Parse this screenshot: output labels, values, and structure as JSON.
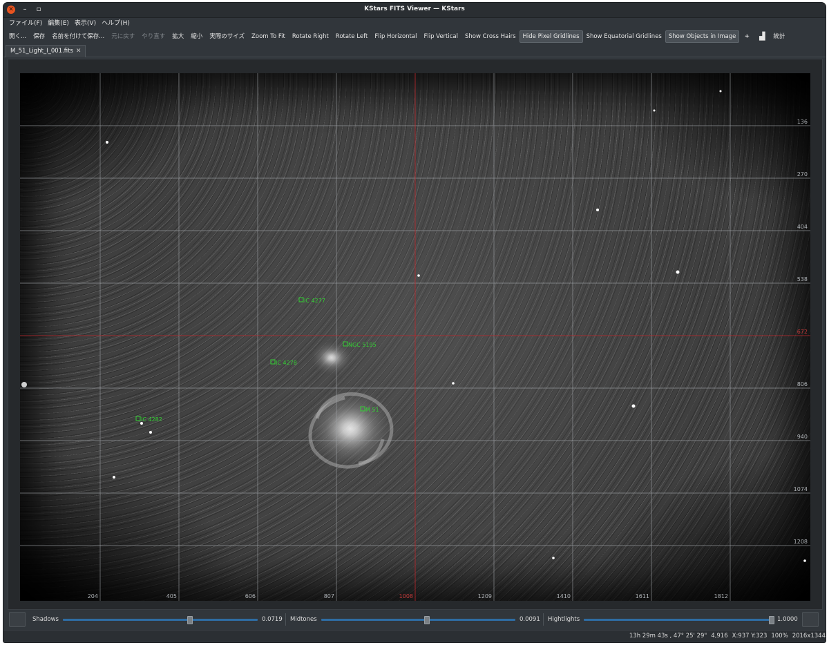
{
  "window": {
    "title": "KStars FITS Viewer — KStars",
    "close_glyph": "✕",
    "minimize_glyph": "–",
    "maximize_glyph": "▫"
  },
  "menu": [
    "ファイル(F)",
    "編集(E)",
    "表示(V)",
    "ヘルプ(H)"
  ],
  "toolbar": [
    {
      "label": "開く...",
      "state": "normal"
    },
    {
      "label": "保存",
      "state": "normal"
    },
    {
      "label": "名前を付けて保存...",
      "state": "normal"
    },
    {
      "label": "元に戻す",
      "state": "disabled"
    },
    {
      "label": "やり直す",
      "state": "disabled"
    },
    {
      "label": "拡大",
      "state": "normal"
    },
    {
      "label": "縮小",
      "state": "normal"
    },
    {
      "label": "実際のサイズ",
      "state": "normal"
    },
    {
      "label": "Zoom To Fit",
      "state": "normal"
    },
    {
      "label": "Rotate Right",
      "state": "normal"
    },
    {
      "label": "Rotate Left",
      "state": "normal"
    },
    {
      "label": "Flip Horizontal",
      "state": "normal"
    },
    {
      "label": "Flip Vertical",
      "state": "normal"
    },
    {
      "label": "Show Cross Hairs",
      "state": "normal"
    },
    {
      "label": "Hide Pixel Gridlines",
      "state": "checked"
    },
    {
      "label": "Show Equatorial Gridlines",
      "state": "normal"
    },
    {
      "label": "Show Objects in Image",
      "state": "checked"
    }
  ],
  "toolbar_icons": {
    "crosshair": "⌖",
    "histogram": "▟"
  },
  "toolbar_stats_label": "統計",
  "tab": {
    "label": "M_51_Light_I_001.fits",
    "close_glyph": "✕"
  },
  "image": {
    "x_axis_labels": [
      "204",
      "405",
      "606",
      "807",
      "1008",
      "1209",
      "1410",
      "1611",
      "1812"
    ],
    "y_axis_labels": [
      "136",
      "270",
      "404",
      "538",
      "672",
      "806",
      "940",
      "1074",
      "1208"
    ],
    "crosshair_x_label": "1008",
    "crosshair_y_label": "672",
    "objects": [
      {
        "name": "IC 4277"
      },
      {
        "name": "NGC 5195"
      },
      {
        "name": "IC 4278"
      },
      {
        "name": "M 51"
      },
      {
        "name": "IC 4282"
      }
    ],
    "colors": {
      "object_marker": "#33d133",
      "crosshair": "#c0262b",
      "grid": "#9ea2a6"
    }
  },
  "stretch": {
    "shadows": {
      "label": "Shadows",
      "value": "0.0719",
      "fraction": 0.65
    },
    "midtones": {
      "label": "Midtones",
      "value": "0.0091",
      "fraction": 0.54
    },
    "highlights": {
      "label": "Hightlights",
      "value": "1.0000",
      "fraction": 0.99
    }
  },
  "status": {
    "coords": "13h 29m 43s ,  47° 25' 29\"",
    "value": "4,916",
    "pixel": "X:937 Y:323",
    "zoom": "100%",
    "size": "2016x1344"
  }
}
